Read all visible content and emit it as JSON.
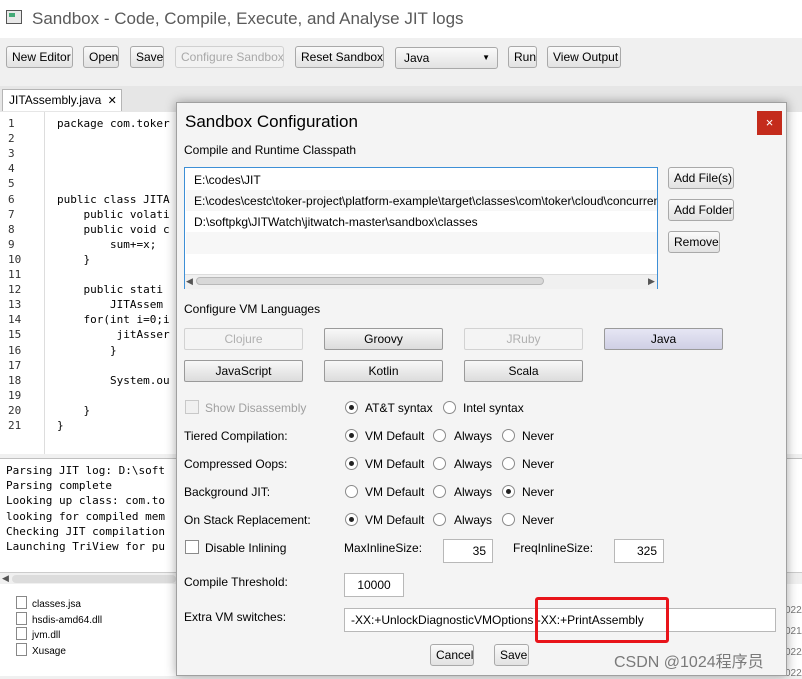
{
  "window": {
    "title": "Sandbox - Code, Compile, Execute, and Analyse JIT logs"
  },
  "toolbar": {
    "new_editor": "New Editor",
    "open": "Open",
    "save": "Save",
    "configure_sandbox": "Configure Sandbox",
    "reset_sandbox": "Reset Sandbox",
    "language_select": "Java",
    "run": "Run",
    "view_output": "View Output"
  },
  "editor": {
    "tab_label": "JITAssembly.java",
    "tab_close": "✕",
    "line_numbers": [
      "1",
      "2",
      "3",
      "4",
      "5",
      "6",
      "7",
      "8",
      "9",
      "10",
      "11",
      "12",
      "13",
      "14",
      "15",
      "16",
      "17",
      "18",
      "19",
      "20",
      "21"
    ],
    "lines": [
      "package com.toker",
      "",
      "",
      "",
      "",
      "public class JITA",
      "    public volati",
      "    public void c",
      "        sum+=x;",
      "    }",
      "",
      "    public stati",
      "        JITAssem",
      "    for(int i=0;i",
      "         jitAsser",
      "        }",
      "",
      "        System.ou",
      "",
      "    }",
      "}"
    ]
  },
  "log": {
    "lines": [
      "Parsing JIT log: D:\\soft",
      "Parsing complete",
      "Looking up class: com.to",
      "looking for compiled mem",
      "Checking JIT compilation",
      "Launching TriView for pu"
    ]
  },
  "files": [
    "classes.jsa",
    "hsdis-amd64.dll",
    "jvm.dll",
    "Xusage"
  ],
  "file_dates": [
    "022/",
    "021/",
    "022/",
    "022/"
  ],
  "dialog": {
    "title": "Sandbox Configuration",
    "close": "×",
    "classpath_label": "Compile and Runtime Classpath",
    "classpath": [
      "E:\\codes\\JIT",
      "E:\\codes\\cestc\\toker-project\\platform-example\\target\\classes\\com\\toker\\cloud\\concurren",
      "D:\\softpkg\\JITWatch\\jitwatch-master\\sandbox\\classes"
    ],
    "add_files": "Add File(s)",
    "add_folder": "Add Folder",
    "remove": "Remove",
    "vm_languages_label": "Configure VM Languages",
    "languages": [
      {
        "label": "Clojure",
        "enabled": false
      },
      {
        "label": "Groovy",
        "enabled": true
      },
      {
        "label": "JRuby",
        "enabled": false
      },
      {
        "label": "Java",
        "enabled": true
      },
      {
        "label": "JavaScript",
        "enabled": true
      },
      {
        "label": "Kotlin",
        "enabled": true
      },
      {
        "label": "Scala",
        "enabled": true
      }
    ],
    "show_disassembly": "Show Disassembly",
    "att_syntax": "AT&T syntax",
    "intel_syntax": "Intel syntax",
    "rows": [
      {
        "label": "Tiered Compilation:",
        "selected": "VM Default"
      },
      {
        "label": "Compressed Oops:",
        "selected": "VM Default"
      },
      {
        "label": "Background JIT:",
        "selected": "Never"
      },
      {
        "label": "On Stack Replacement:",
        "selected": "VM Default"
      }
    ],
    "opt_vm_default": "VM Default",
    "opt_always": "Always",
    "opt_never": "Never",
    "disable_inlining": "Disable Inlining",
    "max_inline_size_label": "MaxInlineSize:",
    "max_inline_size": "35",
    "freq_inline_size_label": "FreqInlineSize:",
    "freq_inline_size": "325",
    "compile_threshold_label": "Compile Threshold:",
    "compile_threshold": "10000",
    "extra_vm_label": "Extra VM switches:",
    "extra_vm_value": "-XX:+UnlockDiagnosticVMOptions -XX:+PrintAssembly",
    "cancel": "Cancel",
    "save": "Save"
  },
  "watermark": "CSDN @1024程序员",
  "colors": {
    "highlight": "#e8141a",
    "close_red": "#c42b1c",
    "focus_blue": "#3d8fd6"
  }
}
